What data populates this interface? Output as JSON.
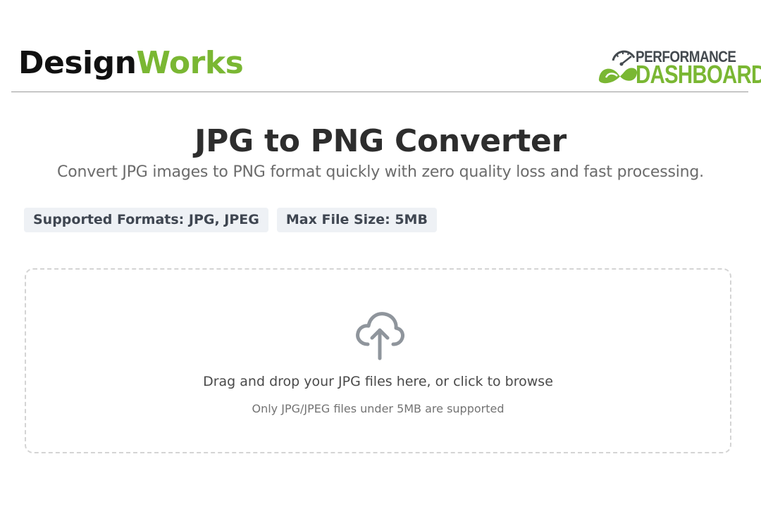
{
  "header": {
    "brand_part1": "Design",
    "brand_part2": "Works",
    "logo": {
      "top_text": "PERFORMANCE",
      "bottom_text": "DASHBOARD",
      "icon": "speedometer-infinity-icon"
    }
  },
  "main": {
    "title": "JPG to PNG Converter",
    "subtitle": "Convert JPG images to PNG format quickly with zero quality loss and fast processing."
  },
  "badges": [
    {
      "label": "Supported Formats: JPG, JPEG"
    },
    {
      "label": "Max File Size: 5MB"
    }
  ],
  "dropzone": {
    "icon": "cloud-upload-icon",
    "main_text": "Drag and drop your JPG files here, or click to browse",
    "hint_text": "Only JPG/JPEG files under 5MB are supported"
  },
  "colors": {
    "brand_green": "#7ab733",
    "brand_black": "#111111",
    "badge_bg": "#eef1f5",
    "icon_gray": "#8f959c",
    "dashed_border": "#d4d4d4"
  }
}
